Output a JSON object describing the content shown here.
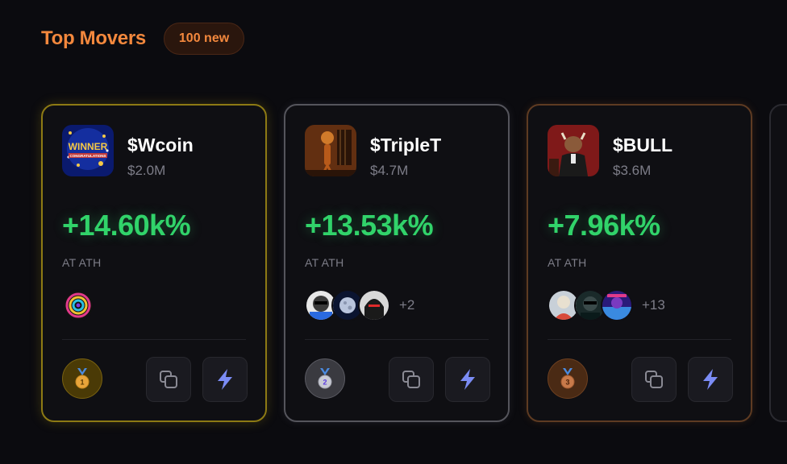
{
  "header": {
    "title": "Top Movers",
    "badge": "100 new"
  },
  "cards": [
    {
      "ticker": "$Wcoin",
      "mcap": "$2.0M",
      "change": "+14.60k%",
      "status": "AT ATH",
      "rank": "1",
      "extra_holders": ""
    },
    {
      "ticker": "$TripleT",
      "mcap": "$4.7M",
      "change": "+13.53k%",
      "status": "AT ATH",
      "rank": "2",
      "extra_holders": "+2"
    },
    {
      "ticker": "$BULL",
      "mcap": "$3.6M",
      "change": "+7.96k%",
      "status": "AT ATH",
      "rank": "3",
      "extra_holders": "+13"
    }
  ],
  "colors": {
    "accent": "#f3883d",
    "positive": "#31d36a",
    "muted": "#7d7d88",
    "gold": "#8d7a14",
    "silver": "#55555c",
    "bronze": "#5e3b22"
  }
}
